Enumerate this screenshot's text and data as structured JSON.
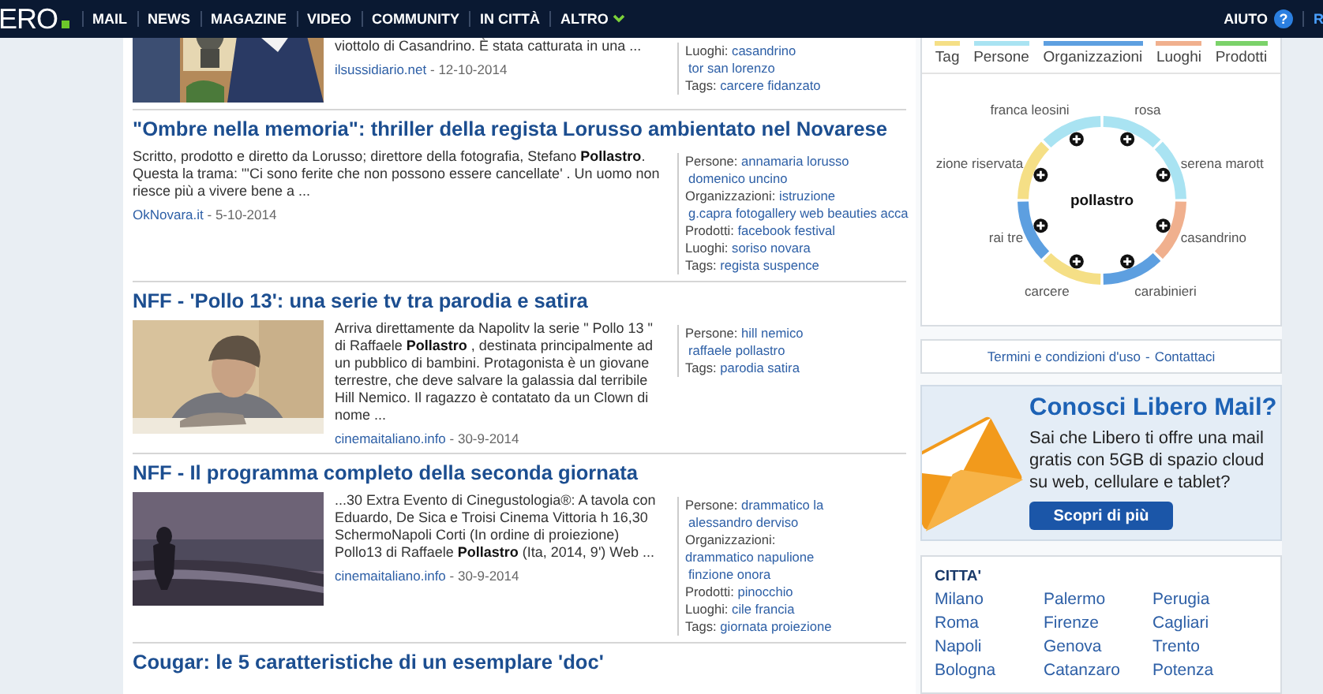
{
  "nav": {
    "logo": "ERO",
    "items": [
      {
        "label": "MAIL",
        "dropdown": false
      },
      {
        "label": "NEWS",
        "dropdown": false
      },
      {
        "label": "MAGAZINE",
        "dropdown": false
      },
      {
        "label": "VIDEO",
        "dropdown": false
      },
      {
        "label": "COMMUNITY",
        "dropdown": false
      },
      {
        "label": "IN CITTÀ",
        "dropdown": false
      },
      {
        "label": "ALTRO",
        "dropdown": true
      }
    ],
    "help": {
      "label": "AIUTO",
      "icon": "?"
    },
    "cut_link": "R"
  },
  "articles": [
    {
      "kind": "picture",
      "partial": true,
      "body": "viottolo di Casandrino. È stata catturata in una ...",
      "source": "ilsussidiario.net",
      "date": "- 12-10-2014",
      "tags": [
        {
          "label": "Luoghi:",
          "values": [
            "casandrino",
            "tor san lorenzo"
          ]
        },
        {
          "label": "Tags:",
          "values": [
            "carcere fidanzato"
          ]
        }
      ]
    },
    {
      "kind": "text",
      "title": "\"Ombre nella memoria\": thriller della regista Lorusso ambientato nel Novarese",
      "body": "Scritto, prodotto e diretto da Lorusso; direttore della fotografia, Stefano **Pollastro**. Questa la trama: \"'Ci sono ferite che non possono essere cancellate' . Un uomo non riesce più a vivere bene a ...",
      "source": "OkNovara.it",
      "date": "- 5-10-2014",
      "tags": [
        {
          "label": "Persone:",
          "values": [
            "annamaria lorusso",
            "domenico uncino"
          ]
        },
        {
          "label": "Organizzazioni:",
          "values": [
            "istruzione",
            "g.capra fotogallery web beauties acca"
          ]
        },
        {
          "label": "Prodotti:",
          "values": [
            "facebook festival"
          ]
        },
        {
          "label": "Luoghi:",
          "values": [
            "soriso novara"
          ]
        },
        {
          "label": "Tags:",
          "values": [
            "regista suspence"
          ]
        }
      ]
    },
    {
      "kind": "picture",
      "title": "NFF - 'Pollo 13': una serie tv tra parodia e satira",
      "body": "Arriva direttamente da Napolitv la serie \" Pollo 13 \" di Raffaele **Pollastro** , destinata principalmente ad un pubblico di bambini. Protagonista è un giovane terrestre, che deve salvare la galassia dal terribile Hill Nemico. Il ragazzo è contatato da un Clown di nome ...",
      "source": "cinemaitaliano.info",
      "date": "- 30-9-2014",
      "tags": [
        {
          "label": "Persone:",
          "values": [
            "hill nemico",
            "raffaele pollastro"
          ]
        },
        {
          "label": "Tags:",
          "values": [
            "parodia satira"
          ]
        }
      ]
    },
    {
      "kind": "picture",
      "title": "NFF - Il programma completo della seconda giornata",
      "body": "...30 Extra Evento di Cinegustologia®: A tavola con Eduardo, De Sica e Troisi Cinema Vittoria h 16,30 SchermoNapoli Corti (In ordine di proiezione) Pollo13 di Raffaele **Pollastro** (Ita, 2014, 9') Web ...",
      "source": "cinemaitaliano.info",
      "date": "- 30-9-2014",
      "tags": [
        {
          "label": "Persone:",
          "values": [
            "drammatico la",
            "alessandro derviso"
          ]
        },
        {
          "label": "Organizzazioni:",
          "values": [
            "drammatico napulione",
            "finzione onora"
          ]
        },
        {
          "label": "Prodotti:",
          "values": [
            "pinocchio"
          ]
        },
        {
          "label": "Luoghi:",
          "values": [
            "cile francia"
          ]
        },
        {
          "label": "Tags:",
          "values": [
            "giornata proiezione"
          ]
        }
      ]
    },
    {
      "kind": "text",
      "title": "Cougar: le 5 caratteristiche di un esemplare 'doc'"
    }
  ],
  "graph": {
    "legend": [
      {
        "label": "Tag",
        "color": "#f5df86"
      },
      {
        "label": "Persone",
        "color": "#a9e3f2"
      },
      {
        "label": "Organizzazioni",
        "color": "#5d9fe0"
      },
      {
        "label": "Luoghi",
        "color": "#f0b08e"
      },
      {
        "label": "Prodotti",
        "color": "#7bd26a"
      }
    ],
    "center": "pollastro",
    "nodes": [
      {
        "label": "franca leosini",
        "color": "#a9e3f2"
      },
      {
        "label": "rosa",
        "color": "#a9e3f2"
      },
      {
        "label": "zione riservata",
        "color": "#f5df86"
      },
      {
        "label": "serena marott",
        "color": "#a9e3f2"
      },
      {
        "label": "rai tre",
        "color": "#5d9fe0"
      },
      {
        "label": "casandrino",
        "color": "#f0b08e"
      },
      {
        "label": "carcere",
        "color": "#f5df86"
      },
      {
        "label": "carabinieri",
        "color": "#5d9fe0"
      }
    ]
  },
  "footer_links": {
    "links": [
      "Termini e condizioni d'uso",
      "Contattaci"
    ],
    "separator": "-"
  },
  "promo": {
    "title": "Conosci Libero Mail?",
    "text": "Sai che Libero ti offre una mail gratis con 5GB di spazio cloud su web, cellulare e tablet?",
    "button": "Scopri di più"
  },
  "cities": {
    "title": "CITTA'",
    "items": [
      "Milano",
      "Palermo",
      "Perugia",
      "Roma",
      "Firenze",
      "Cagliari",
      "Napoli",
      "Genova",
      "Trento",
      "Bologna",
      "Catanzaro",
      "Potenza"
    ]
  }
}
